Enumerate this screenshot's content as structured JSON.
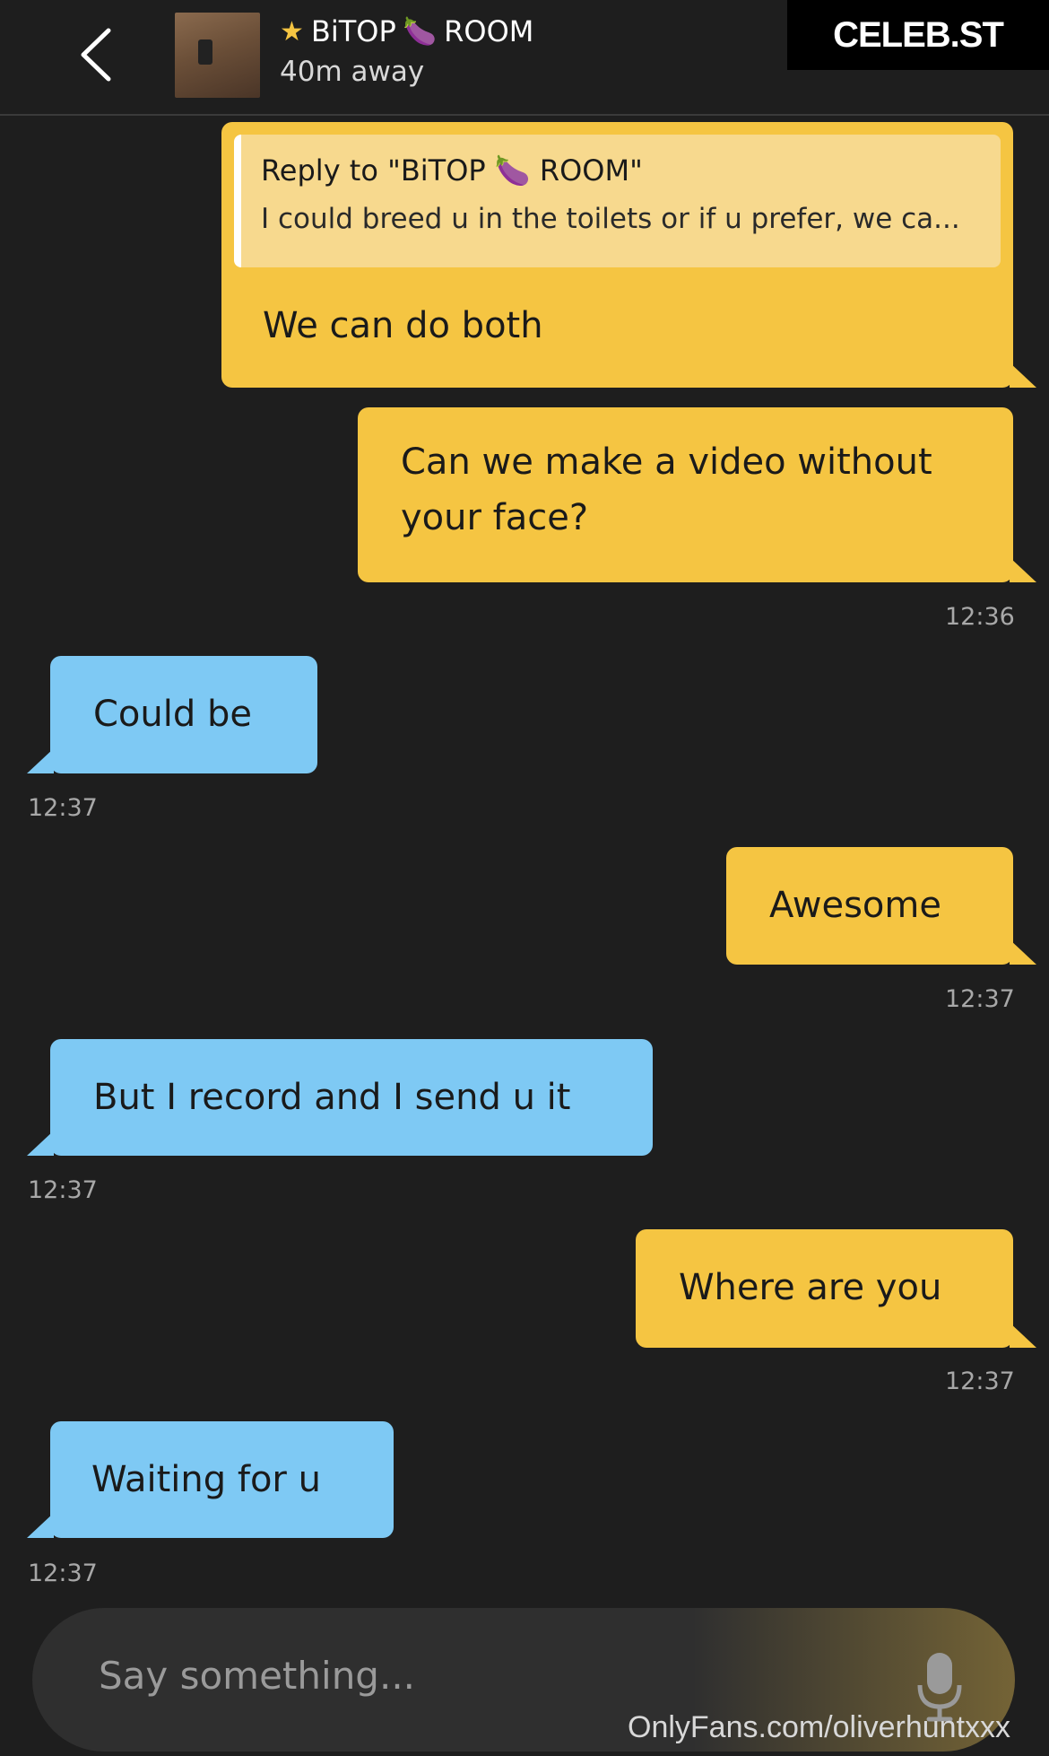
{
  "header": {
    "contact_name": "BiTOP",
    "contact_name_suffix": "ROOM",
    "distance": "40m away",
    "logo": "CELEB.ST",
    "icons": [
      "back-chevron-icon",
      "star-icon",
      "eggplant-icon"
    ]
  },
  "messages": [
    {
      "side": "sent",
      "reply_to": "Reply to \"BiTOP 🍆 ROOM\"",
      "quote": "I could breed u in the toilets or if u prefer, we ca...",
      "text": "We can do both"
    },
    {
      "side": "sent",
      "text_line1": "Can we make a video without",
      "text_line2": "your face?",
      "time": "12:36"
    },
    {
      "side": "recv",
      "text": "Could be",
      "time": "12:37"
    },
    {
      "side": "sent",
      "text": "Awesome",
      "time": "12:37"
    },
    {
      "side": "recv",
      "text": "But I record and I send u it",
      "time": "12:37"
    },
    {
      "side": "sent",
      "text": "Where are you",
      "time": "12:37"
    },
    {
      "side": "recv",
      "text": "Waiting for u",
      "time": "12:37"
    }
  ],
  "input": {
    "placeholder": "Say something...",
    "mic_icon": "microphone-icon"
  },
  "watermark": "OnlyFans.com/oliverhuntxxx",
  "colors": {
    "sent": "#f5c542",
    "received": "#7ec9f4",
    "background": "#1e1e1e"
  }
}
